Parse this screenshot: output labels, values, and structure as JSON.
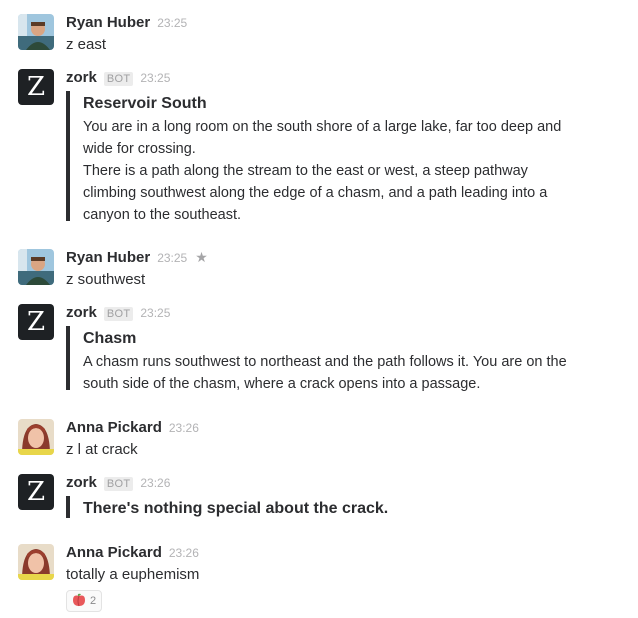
{
  "colors": {
    "text": "#2c2d30",
    "muted": "#b3b3b5",
    "bot_bg": "#1e2124"
  },
  "messages": [
    {
      "author": "Ryan Huber",
      "time": "23:25",
      "text": "z east",
      "avatar": "ryan-avatar"
    },
    {
      "author": "zork",
      "badge": "BOT",
      "time": "23:25",
      "avatar": "zork-avatar",
      "avatar_letter": "Z",
      "attachment": {
        "title": "Reservoir South",
        "body": "You are in a long room on the south shore of a large lake, far too deep and\n wide for crossing.\n There is a path along the stream to the east or west, a steep pathway\n climbing southwest along the edge of a chasm, and a path leading into a\n canyon to the southeast."
      }
    },
    {
      "author": "Ryan Huber",
      "time": "23:25",
      "text": "z southwest",
      "avatar": "ryan-avatar",
      "starred_icon": "star-icon"
    },
    {
      "author": "zork",
      "badge": "BOT",
      "time": "23:25",
      "avatar": "zork-avatar",
      "avatar_letter": "Z",
      "attachment": {
        "title": "Chasm",
        "body": "A chasm runs southwest to northeast and the path follows it. You are on the\n south side of the chasm, where a crack opens into a passage."
      }
    },
    {
      "author": "Anna Pickard",
      "time": "23:26",
      "text": "z l at crack",
      "avatar": "anna-avatar"
    },
    {
      "author": "zork",
      "badge": "BOT",
      "time": "23:26",
      "avatar": "zork-avatar",
      "avatar_letter": "Z",
      "attachment": {
        "title": "There's nothing special about the crack."
      }
    },
    {
      "author": "Anna Pickard",
      "time": "23:26",
      "text": "totally a euphemism",
      "avatar": "anna-avatar",
      "reaction": {
        "emoji": "peach-emoji",
        "count": "2"
      }
    }
  ]
}
